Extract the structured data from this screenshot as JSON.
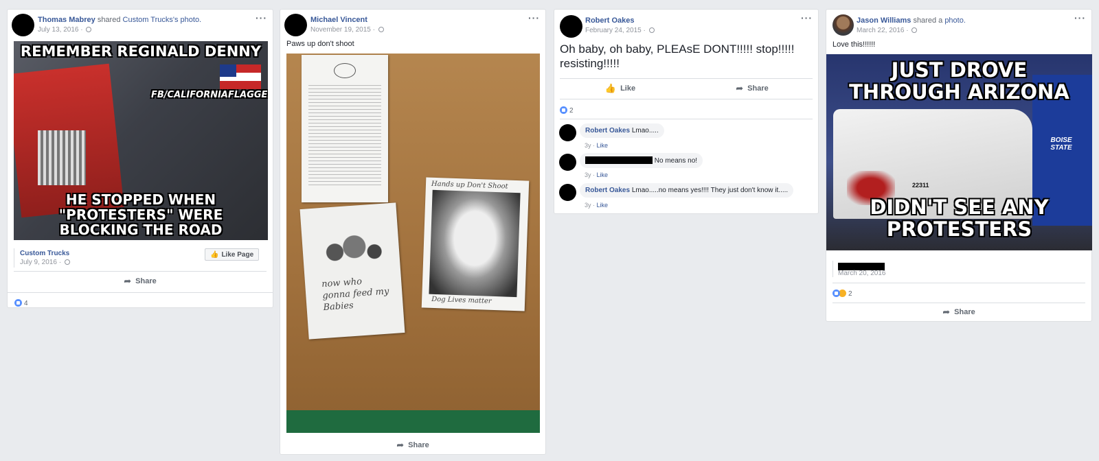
{
  "colors": {
    "background": "#e9ebee",
    "link": "#385898",
    "like": "#5890ff"
  },
  "posts": [
    {
      "author": "Thomas Mabrey",
      "action": "shared",
      "target": "Custom Trucks",
      "target_suffix": "'s photo.",
      "date": "July 13, 2016 ·",
      "meme_top": "REMEMBER REGINALD DENNY",
      "meme_tag": "FB/CALIFORNIAFLAGGERS",
      "meme_bottom": "HE STOPPED WHEN \"PROTESTERS\" WERE BLOCKING THE ROAD",
      "page_name": "Custom Trucks",
      "page_date": "July 9, 2016 ·",
      "like_page": "Like Page",
      "share": "Share",
      "reactions": "4"
    },
    {
      "author": "Michael Vincent",
      "date": "November 19, 2015 ·",
      "text": "Paws up don't shoot",
      "note1": "now who gonna feed my Babies",
      "note2_top": "Hands up Don't Shoot",
      "note2_bottom": "Dog Lives matter",
      "share": "Share"
    },
    {
      "author": "Robert Oakes",
      "date": "February 24, 2015 ·",
      "text": "Oh baby, oh baby, PLEAsE DONT!!!!! stop!!!!! resisting!!!!!",
      "like": "Like",
      "share": "Share",
      "reactions": "2",
      "comments": [
        {
          "author": "Robert Oakes",
          "text": "Lmao.....",
          "meta_time": "3y",
          "meta_like": "Like"
        },
        {
          "author": "",
          "text": "No means no!",
          "meta_time": "3y",
          "meta_like": "Like"
        },
        {
          "author": "Robert Oakes",
          "text": "Lmao.....no means yes!!!! They just don't know it.....",
          "meta_time": "3y",
          "meta_like": "Like"
        }
      ]
    },
    {
      "author": "Jason Williams",
      "action": "shared a",
      "target": "photo.",
      "date": "March 22, 2016 ·",
      "text": "Love this!!!!!!",
      "meme_top": "JUST DROVE THROUGH ARIZONA",
      "meme_bottom": "DIDN'T SEE ANY PROTESTERS",
      "meme_side": "BOISE STATE",
      "meme_number": "22311",
      "shared_date": "March 20, 2016",
      "reactions": "2",
      "share": "Share"
    }
  ]
}
